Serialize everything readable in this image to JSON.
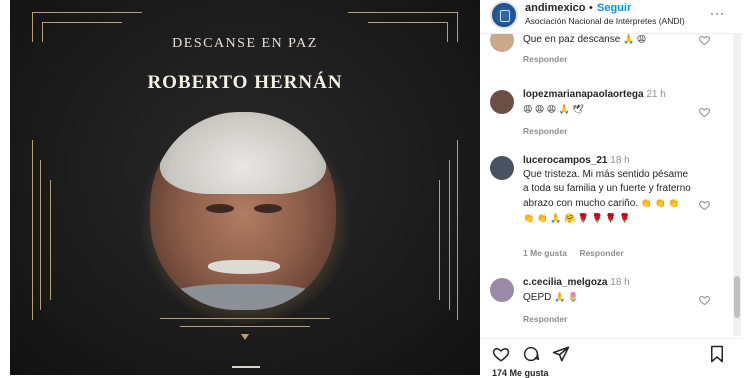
{
  "post": {
    "rip_text": "DESCANSE EN PAZ",
    "name_text": "ROBERTO HERNÁN"
  },
  "header": {
    "account": "andimexico",
    "separator": "•",
    "follow_label": "Seguir",
    "subtitle": "Asociación Nacional de Intérpretes (ANDI)",
    "more_label": "···"
  },
  "comments": [
    {
      "username": "",
      "time": "",
      "text": "Que en paz descanse",
      "emojis": "🙏 😩",
      "meta": [
        "Responder"
      ],
      "avatar_color": "#c9a98a"
    },
    {
      "username": "lopezmarianapaolaortega",
      "time": "21 h",
      "text": "",
      "emojis": "😩 😩 😩 🙏 🕊",
      "meta": [
        "Responder"
      ],
      "avatar_color": "#6b4f44"
    },
    {
      "username": "lucerocampos_21",
      "time": "18 h",
      "text": "Que tristeza. Mi más sentido pésame a toda su familia y un fuerte y fraterno abrazo con mucho cariño.",
      "emojis": "👏 👏 👏 👏 👏 🙏 🤗 🌹 🌹 🌹 🌹",
      "meta": [
        "1 Me gusta",
        "Responder"
      ],
      "avatar_color": "#4a5160"
    },
    {
      "username": "c.cecilia_melgoza",
      "time": "18 h",
      "text": "QEPD",
      "emojis": "🙏 🌷",
      "meta": [
        "Responder"
      ],
      "avatar_color": "#9a8aa8"
    }
  ],
  "actions": {
    "like": "heart-icon",
    "comment": "comment-icon",
    "share": "share-icon",
    "save": "bookmark-icon"
  },
  "likes_text": "174 Me gusta",
  "colors": {
    "follow": "#0095f6",
    "text": "#262626",
    "muted": "#8e8e8e",
    "gold": "#b8a071"
  }
}
